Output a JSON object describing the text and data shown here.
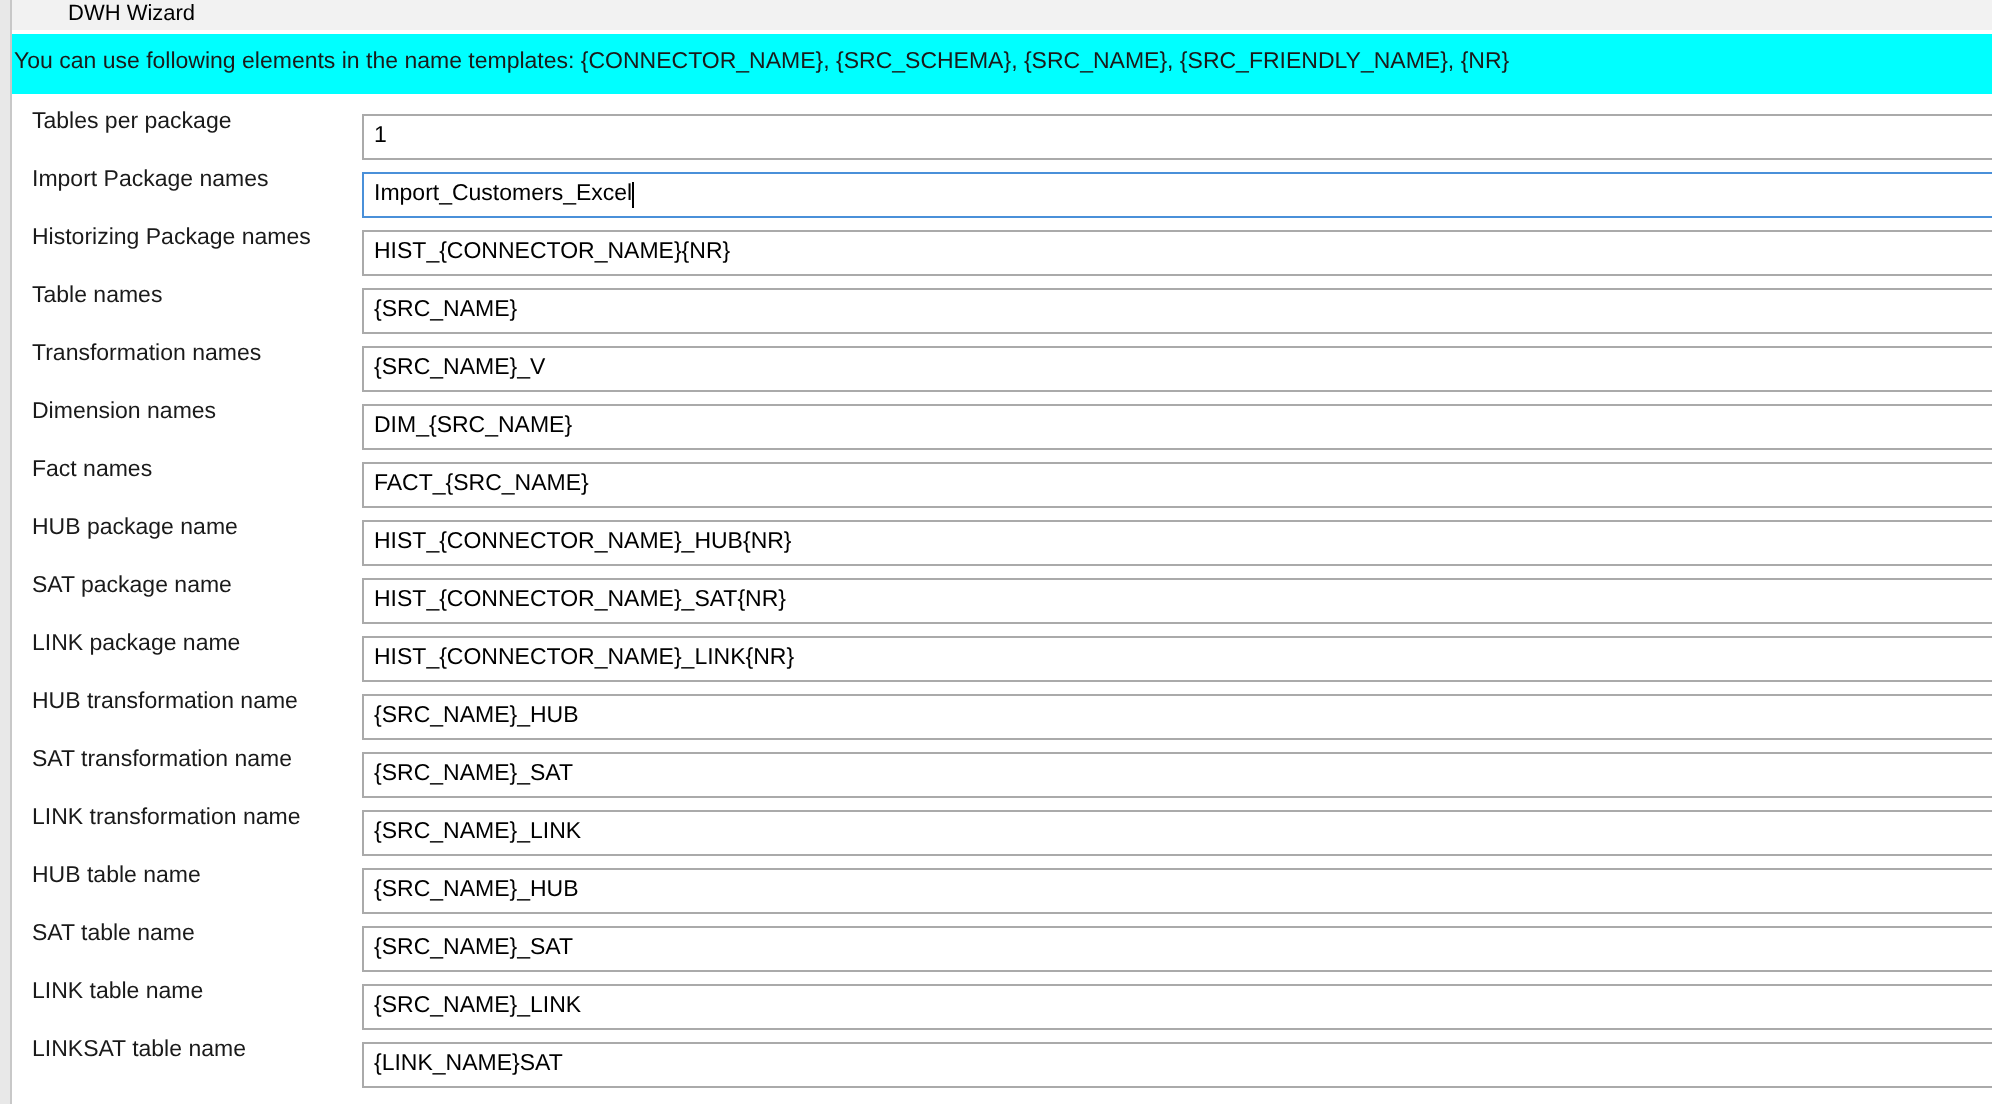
{
  "window": {
    "title": "DWH Wizard"
  },
  "banner": "You can use following elements in the name templates: {CONNECTOR_NAME}, {SRC_SCHEMA}, {SRC_NAME}, {SRC_FRIENDLY_NAME}, {NR}",
  "fields": [
    {
      "label": "Tables per package",
      "value": "1",
      "focused": false
    },
    {
      "label": "Import Package names",
      "value": "Import_Customers_Excel",
      "focused": true
    },
    {
      "label": "Historizing Package names",
      "value": "HIST_{CONNECTOR_NAME}{NR}",
      "focused": false
    },
    {
      "label": "Table names",
      "value": "{SRC_NAME}",
      "focused": false
    },
    {
      "label": "Transformation names",
      "value": "{SRC_NAME}_V",
      "focused": false
    },
    {
      "label": "Dimension names",
      "value": "DIM_{SRC_NAME}",
      "focused": false
    },
    {
      "label": "Fact names",
      "value": "FACT_{SRC_NAME}",
      "focused": false
    },
    {
      "label": "HUB package name",
      "value": "HIST_{CONNECTOR_NAME}_HUB{NR}",
      "focused": false
    },
    {
      "label": "SAT package name",
      "value": "HIST_{CONNECTOR_NAME}_SAT{NR}",
      "focused": false
    },
    {
      "label": "LINK package name",
      "value": "HIST_{CONNECTOR_NAME}_LINK{NR}",
      "focused": false
    },
    {
      "label": "HUB transformation name",
      "value": "{SRC_NAME}_HUB",
      "focused": false
    },
    {
      "label": "SAT transformation name",
      "value": "{SRC_NAME}_SAT",
      "focused": false
    },
    {
      "label": "LINK transformation name",
      "value": "{SRC_NAME}_LINK",
      "focused": false
    },
    {
      "label": "HUB table name",
      "value": "{SRC_NAME}_HUB",
      "focused": false
    },
    {
      "label": "SAT table name",
      "value": "{SRC_NAME}_SAT",
      "focused": false
    },
    {
      "label": "LINK table name",
      "value": "{SRC_NAME}_LINK",
      "focused": false
    },
    {
      "label": "LINKSAT table name",
      "value": "{LINK_NAME}SAT",
      "focused": false
    }
  ]
}
